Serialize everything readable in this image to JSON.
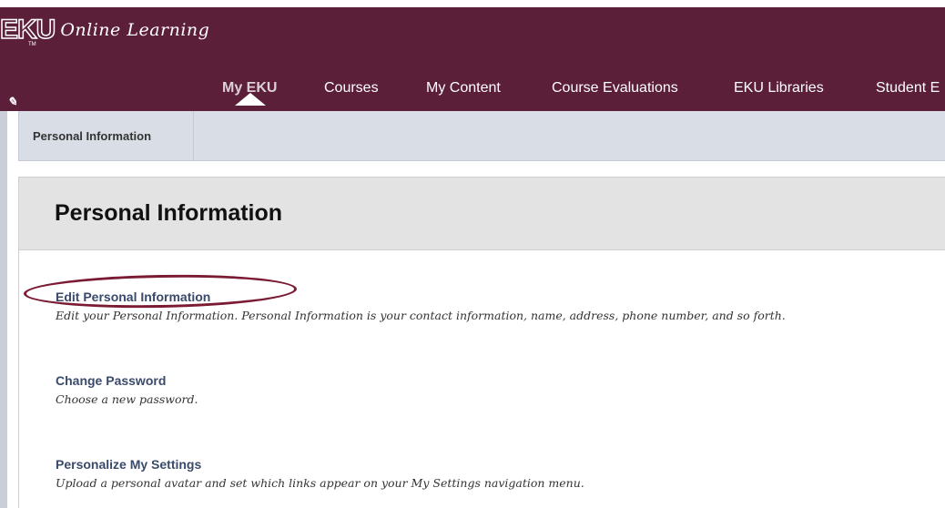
{
  "header": {
    "logo_main": "EKU",
    "logo_sub": "TM",
    "logo_text": "Online Learning",
    "pencil_glyph": "✎"
  },
  "nav": {
    "items": [
      {
        "label": "My EKU",
        "active": true
      },
      {
        "label": "Courses",
        "active": false
      },
      {
        "label": "My Content",
        "active": false
      },
      {
        "label": "Course Evaluations",
        "active": false
      },
      {
        "label": "EKU Libraries",
        "active": false
      },
      {
        "label": "Student E",
        "active": false
      }
    ]
  },
  "breadcrumb": {
    "item": "Personal Information"
  },
  "page": {
    "title": "Personal Information"
  },
  "options": [
    {
      "link": "Edit Personal Information",
      "desc": "Edit your Personal Information. Personal Information is your contact information, name, address, phone number, and so forth.",
      "highlighted": true
    },
    {
      "link": "Change Password",
      "desc": "Choose a new password.",
      "highlighted": false
    },
    {
      "link": "Personalize My Settings",
      "desc": "Upload a personal avatar and set which links appear on your My Settings navigation menu.",
      "highlighted": false
    }
  ],
  "colors": {
    "header_bg": "#5c1f3a",
    "link": "#3a4a6b",
    "highlight_oval": "#7a1a33"
  }
}
